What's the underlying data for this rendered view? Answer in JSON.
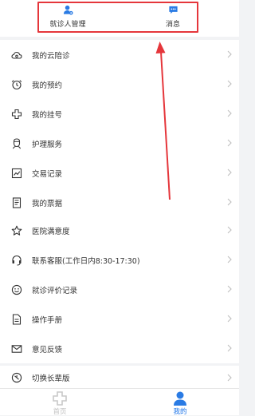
{
  "quick_links": [
    {
      "label": "就诊人管理",
      "icon": "patient-user-icon"
    },
    {
      "label": "消息",
      "icon": "message-icon"
    }
  ],
  "menu_group_1": [
    {
      "label": "我的云陪诊",
      "icon": "cloud-icon"
    },
    {
      "label": "我的预约",
      "icon": "alarm-clock-icon"
    },
    {
      "label": "我的挂号",
      "icon": "medical-cross-icon"
    },
    {
      "label": "护理服务",
      "icon": "nurse-icon"
    },
    {
      "label": "交易记录",
      "icon": "chart-icon"
    },
    {
      "label": "我的票据",
      "icon": "receipt-icon"
    }
  ],
  "menu_group_2": [
    {
      "label": "医院满意度",
      "icon": "star-icon"
    },
    {
      "label": "联系客服(工作日内8:30-17:30)",
      "icon": "headset-icon"
    },
    {
      "label": "就诊评价记录",
      "icon": "smile-icon"
    },
    {
      "label": "操作手册",
      "icon": "document-icon"
    },
    {
      "label": "意见反馈",
      "icon": "mail-icon"
    }
  ],
  "menu_group_3": [
    {
      "label": "切换长辈版",
      "icon": "switch-icon"
    }
  ],
  "tabbar": {
    "home_label": "首页",
    "mine_label": "我的"
  },
  "colors": {
    "accent": "#1a73e8",
    "annotation": "#e5363b",
    "inactive": "#c8c8c8"
  }
}
